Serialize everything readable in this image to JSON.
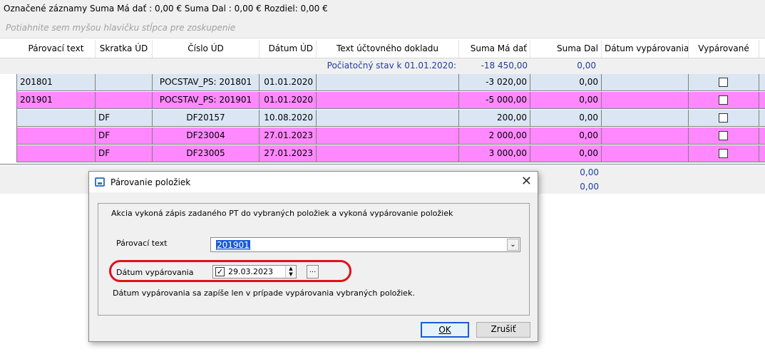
{
  "summary": "Označené záznamy Suma Má dať : 0,00 €  Suma Dal : 0,00 €  Rozdiel: 0,00 €",
  "group_hint": "Potiahnite sem myšou hlavičku stĺpca pre zoskupenie",
  "columns": [
    "Párovací text",
    "Skratka ÚD",
    "Číslo ÚD",
    "Dátum ÚD",
    "Text účtovného dokladu",
    "Suma Má dať",
    "Suma Dal",
    "Dátum vypárovania",
    "Vypárované"
  ],
  "initial": {
    "label": "Počiatočný stav k 01.01.2020:",
    "ma_dat": "-18 450,00",
    "dal": "0,00"
  },
  "rows": [
    {
      "parovaci": "201801",
      "skratka": "",
      "cislo": "POCSTAV_PS: 201801",
      "datum": "01.01.2020",
      "text": "",
      "ma_dat": "-3 020,00",
      "dal": "0,00",
      "datum_vyp": "",
      "color": "blue"
    },
    {
      "parovaci": "201901",
      "skratka": "",
      "cislo": "POCSTAV_PS: 201901",
      "datum": "01.01.2020",
      "text": "",
      "ma_dat": "-5 000,00",
      "dal": "0,00",
      "datum_vyp": "",
      "color": "pink"
    },
    {
      "parovaci": "",
      "skratka": "DF",
      "cislo": "DF20157",
      "datum": "10.08.2020",
      "text": "",
      "ma_dat": "200,00",
      "dal": "0,00",
      "datum_vyp": "",
      "color": "blue"
    },
    {
      "parovaci": "",
      "skratka": "DF",
      "cislo": "DF23004",
      "datum": "27.01.2023",
      "text": "",
      "ma_dat": "2 000,00",
      "dal": "0,00",
      "datum_vyp": "",
      "color": "pink"
    },
    {
      "parovaci": "",
      "skratka": "DF",
      "cislo": "DF23005",
      "datum": "27.01.2023",
      "text": "",
      "ma_dat": "3 000,00",
      "dal": "0,00",
      "datum_vyp": "",
      "color": "pink"
    }
  ],
  "footer": {
    "dal_1": "0,00",
    "dal_2": "0,00"
  },
  "dialog": {
    "title": "Párovanie položiek",
    "close": "✕",
    "info": "Akcia vykoná zápis zadaného PT do vybraných položiek a vykoná  vypárovanie položiek",
    "parovaci_label": "Párovací text",
    "parovaci_value": "201901",
    "datum_label": "Dátum vypárovania",
    "datum_value": "29.03.2023",
    "datum_checked": "✓",
    "note": "Dátum vypárovania sa zapíše len v prípade vypárovania vybraných položiek.",
    "ok_label": "OK",
    "cancel_label": "Zrušiť",
    "accent": "#1a5ad7",
    "highlight_color": "#e0101a"
  }
}
